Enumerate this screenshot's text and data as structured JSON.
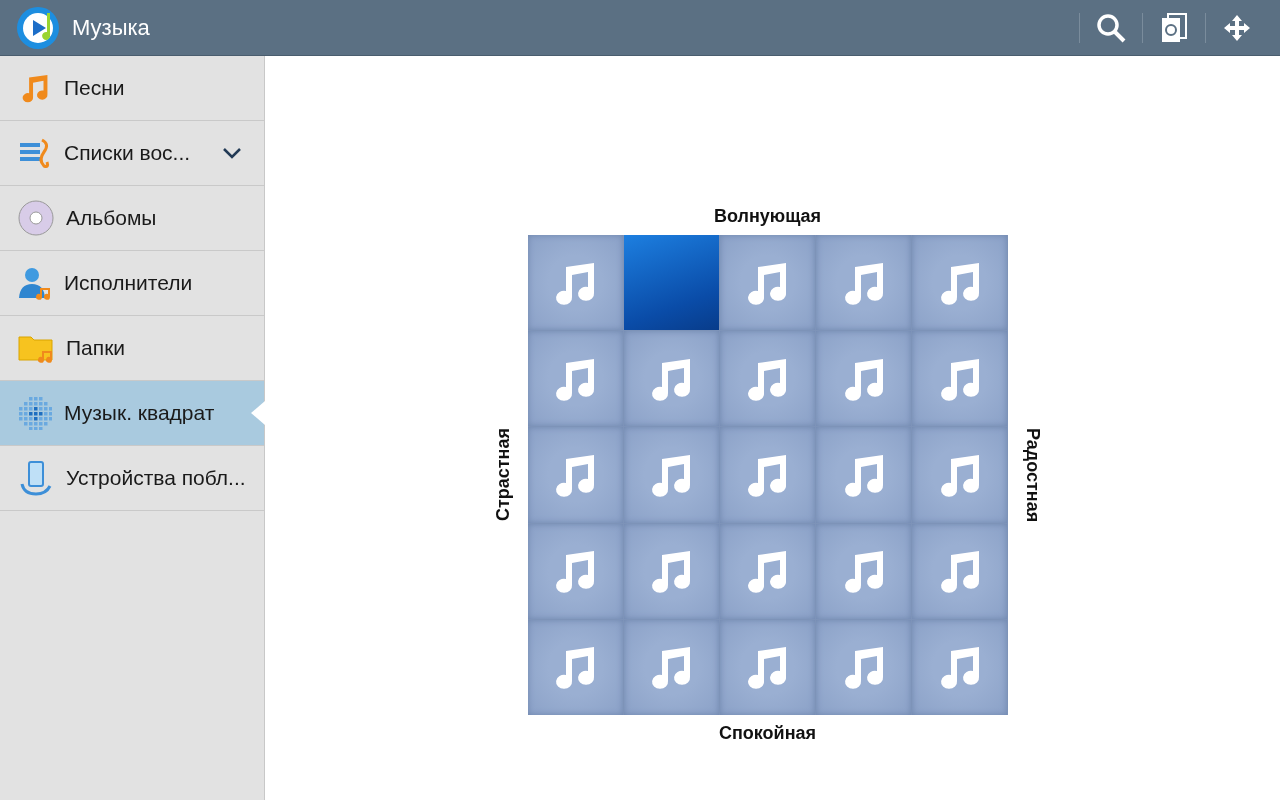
{
  "app_bar": {
    "title": "Музыка"
  },
  "sidebar": {
    "items": [
      {
        "label": "Песни",
        "selected": false,
        "expandable": false
      },
      {
        "label": "Списки вос...",
        "selected": false,
        "expandable": true,
        "expanded": false
      },
      {
        "label": "Альбомы",
        "selected": false,
        "expandable": false
      },
      {
        "label": "Исполнители",
        "selected": false,
        "expandable": false
      },
      {
        "label": "Папки",
        "selected": false,
        "expandable": false
      },
      {
        "label": "Музык. квадрат",
        "selected": true,
        "expandable": false
      },
      {
        "label": "Устройства побл...",
        "selected": false,
        "expandable": false
      }
    ]
  },
  "music_square": {
    "top_label": "Волнующая",
    "bottom_label": "Спокойная",
    "left_label": "Страстная",
    "right_label": "Радостная",
    "tiles": [
      {
        "kind": "note"
      },
      {
        "kind": "cover"
      },
      {
        "kind": "note"
      },
      {
        "kind": "note"
      },
      {
        "kind": "note"
      },
      {
        "kind": "note"
      },
      {
        "kind": "note"
      },
      {
        "kind": "note"
      },
      {
        "kind": "note"
      },
      {
        "kind": "note"
      },
      {
        "kind": "note"
      },
      {
        "kind": "note"
      },
      {
        "kind": "note"
      },
      {
        "kind": "note"
      },
      {
        "kind": "note"
      },
      {
        "kind": "note"
      },
      {
        "kind": "note"
      },
      {
        "kind": "note"
      },
      {
        "kind": "note"
      },
      {
        "kind": "note"
      },
      {
        "kind": "note"
      },
      {
        "kind": "note"
      },
      {
        "kind": "note"
      },
      {
        "kind": "note"
      },
      {
        "kind": "note"
      }
    ]
  }
}
